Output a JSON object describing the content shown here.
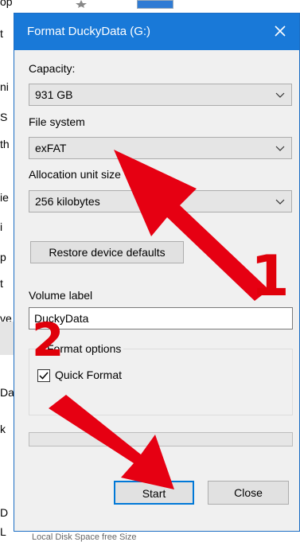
{
  "background": {
    "fragments": [
      "op",
      "t",
      "ni",
      "S",
      "th",
      "ie",
      "i",
      "p",
      "t",
      "ve",
      "Da",
      "k",
      "D",
      "L"
    ],
    "bottom_row_text": "Local Disk          Space free   Size"
  },
  "dialog": {
    "title": "Format DuckyData (G:)",
    "capacity": {
      "label": "Capacity:",
      "value": "931 GB"
    },
    "file_system": {
      "label": "File system",
      "value": "exFAT"
    },
    "allocation": {
      "label": "Allocation unit size",
      "value": "256 kilobytes"
    },
    "restore_button": "Restore device defaults",
    "volume": {
      "label": "Volume label",
      "value": "DuckyData"
    },
    "format_options": {
      "legend": "Format options",
      "quick_format_label": "Quick Format",
      "quick_format_checked": true
    },
    "progress": 0,
    "start_button": "Start",
    "close_button": "Close"
  },
  "annotations": {
    "arrow1_number": "1",
    "arrow2_number": "2",
    "color": "#e0000a"
  },
  "colors": {
    "titlebar": "#1979d8",
    "dialog_bg": "#f0f0f0",
    "accent": "#0078d7"
  }
}
